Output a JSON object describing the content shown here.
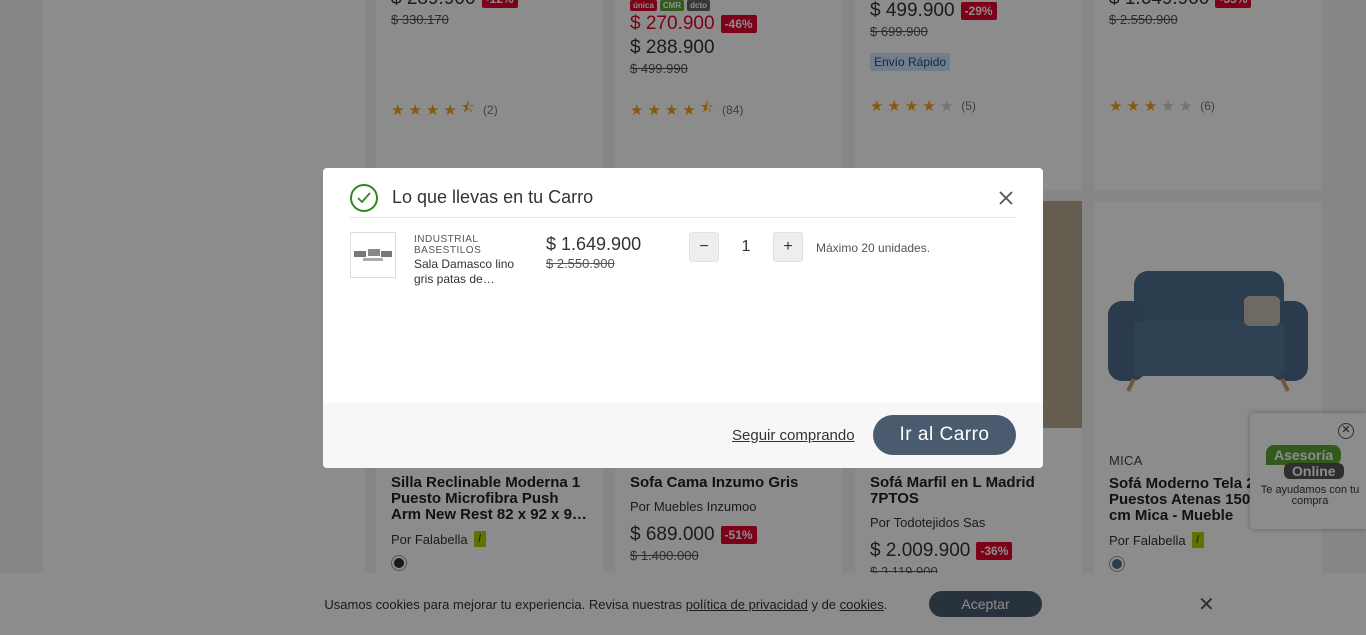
{
  "cards_top": [
    {
      "price": "$ 289.900",
      "discount": "-12%",
      "old_price": "$ 330.170",
      "stars": 4.5,
      "reviews": "(2)"
    },
    {
      "tags": [
        "única",
        "CMR",
        "dcto"
      ],
      "price": "$ 270.900",
      "discount": "-46%",
      "price2": "$ 288.900",
      "old_price": "$ 499.990",
      "stars": 4.5,
      "reviews": "(84)"
    },
    {
      "price": "$ 499.900",
      "discount": "-29%",
      "old_price": "$ 699.900",
      "badge": "Envío Rápido",
      "stars": 4,
      "reviews": "(5)"
    },
    {
      "price": "$ 1.649.900",
      "discount": "-35%",
      "old_price": "$ 2.550.900",
      "stars": 3,
      "reviews": "(6)"
    }
  ],
  "cards_bottom": [
    {
      "brand": "",
      "title": "Silla Reclinable Moderna 1 Puesto Microfibra Push Arm New Rest 82 x 92 x 9…",
      "seller": "Por Falabella",
      "swatch": "#3a2a24"
    },
    {
      "brand": "",
      "title": "Sofa Cama Inzumo Gris",
      "seller": "Por Muebles Inzumoo",
      "price": "$ 689.000",
      "discount": "-51%",
      "old_price": "$ 1.400.000"
    },
    {
      "brand": "",
      "title": "Sofá Marfil en L Madrid 7PTOS",
      "seller": "Por Todotejidos Sas",
      "price": "$ 2.009.900",
      "discount": "-36%",
      "old_price": "$ 3.119.900"
    },
    {
      "brand": "MICA",
      "title": "Sofá Moderno Tela 2 Puestos Atenas 150 x 82 cm Mica - Mueble",
      "seller": "Por Falabella",
      "swatch": "#4f7190"
    }
  ],
  "chat": {
    "line1": "Asesoría",
    "line2": "Online",
    "text": "Te ayudamos con tu compra"
  },
  "cookies": {
    "text": "Usamos cookies para mejorar tu experiencia. Revisa nuestras",
    "privacy_link": "política de privacidad",
    "and": "y de",
    "cookies_link": "cookies",
    "accept": "Aceptar"
  },
  "modal": {
    "title": "Lo que llevas en tu Carro",
    "item": {
      "brand": "INDUSTRIAL BASESTILOS",
      "name": "Sala Damasco lino gris patas de…",
      "price": "$ 1.649.900",
      "old_price": "$ 2.550.900",
      "quantity": "1",
      "max_units": "Máximo 20 unidades."
    },
    "keep_shopping": "Seguir comprando",
    "go_to_cart": "Ir al Carro"
  },
  "colors": {
    "accent": "#4a5b70",
    "discount": "#e4022d",
    "success": "#30871f"
  }
}
